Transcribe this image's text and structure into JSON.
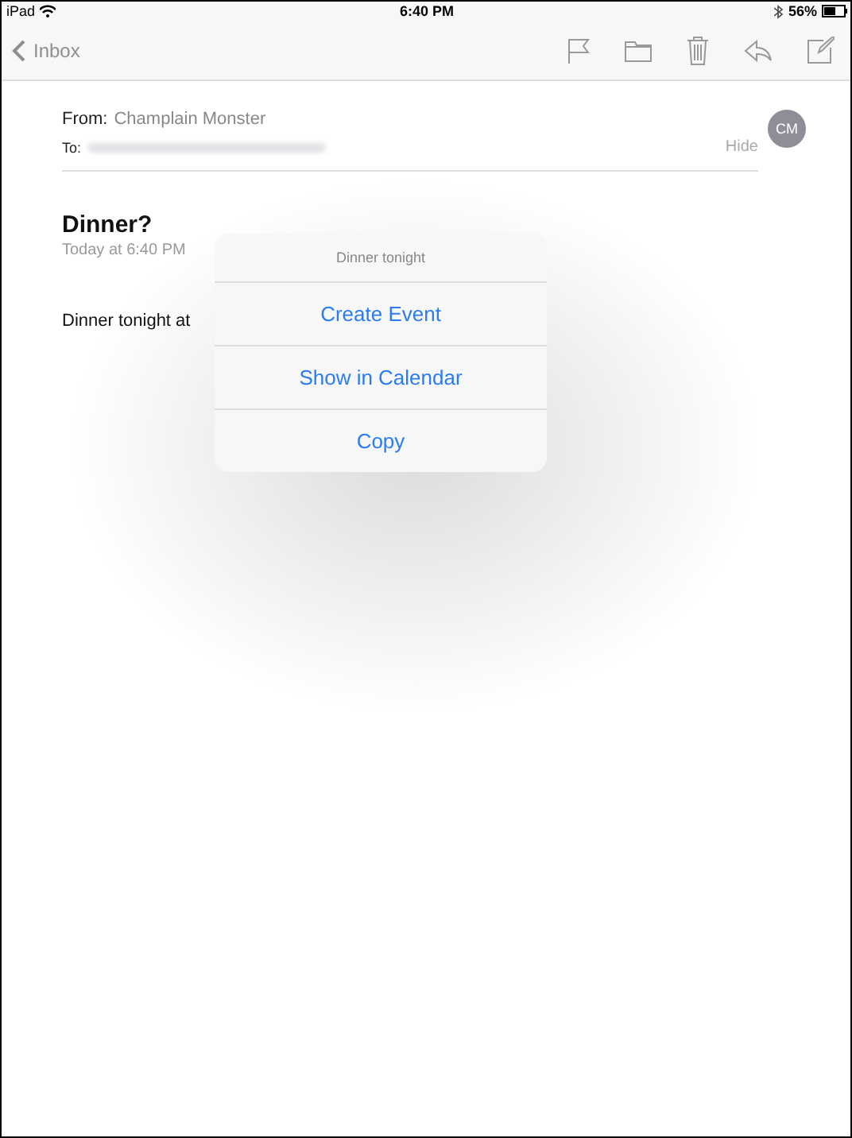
{
  "status_bar": {
    "device": "iPad",
    "time": "6:40 PM",
    "battery": "56%"
  },
  "nav_bar": {
    "back": "Inbox"
  },
  "header": {
    "from_label": "From:",
    "from": "Champlain Monster",
    "to_label": "To:",
    "hide": "Hide",
    "avatar": "CM"
  },
  "message": {
    "subject": "Dinner?",
    "date": "Today at 6:40 PM",
    "body": "Dinner tonight at"
  },
  "popover": {
    "title": "Dinner tonight",
    "actions": [
      "Create Event",
      "Show in Calendar",
      "Copy"
    ]
  }
}
